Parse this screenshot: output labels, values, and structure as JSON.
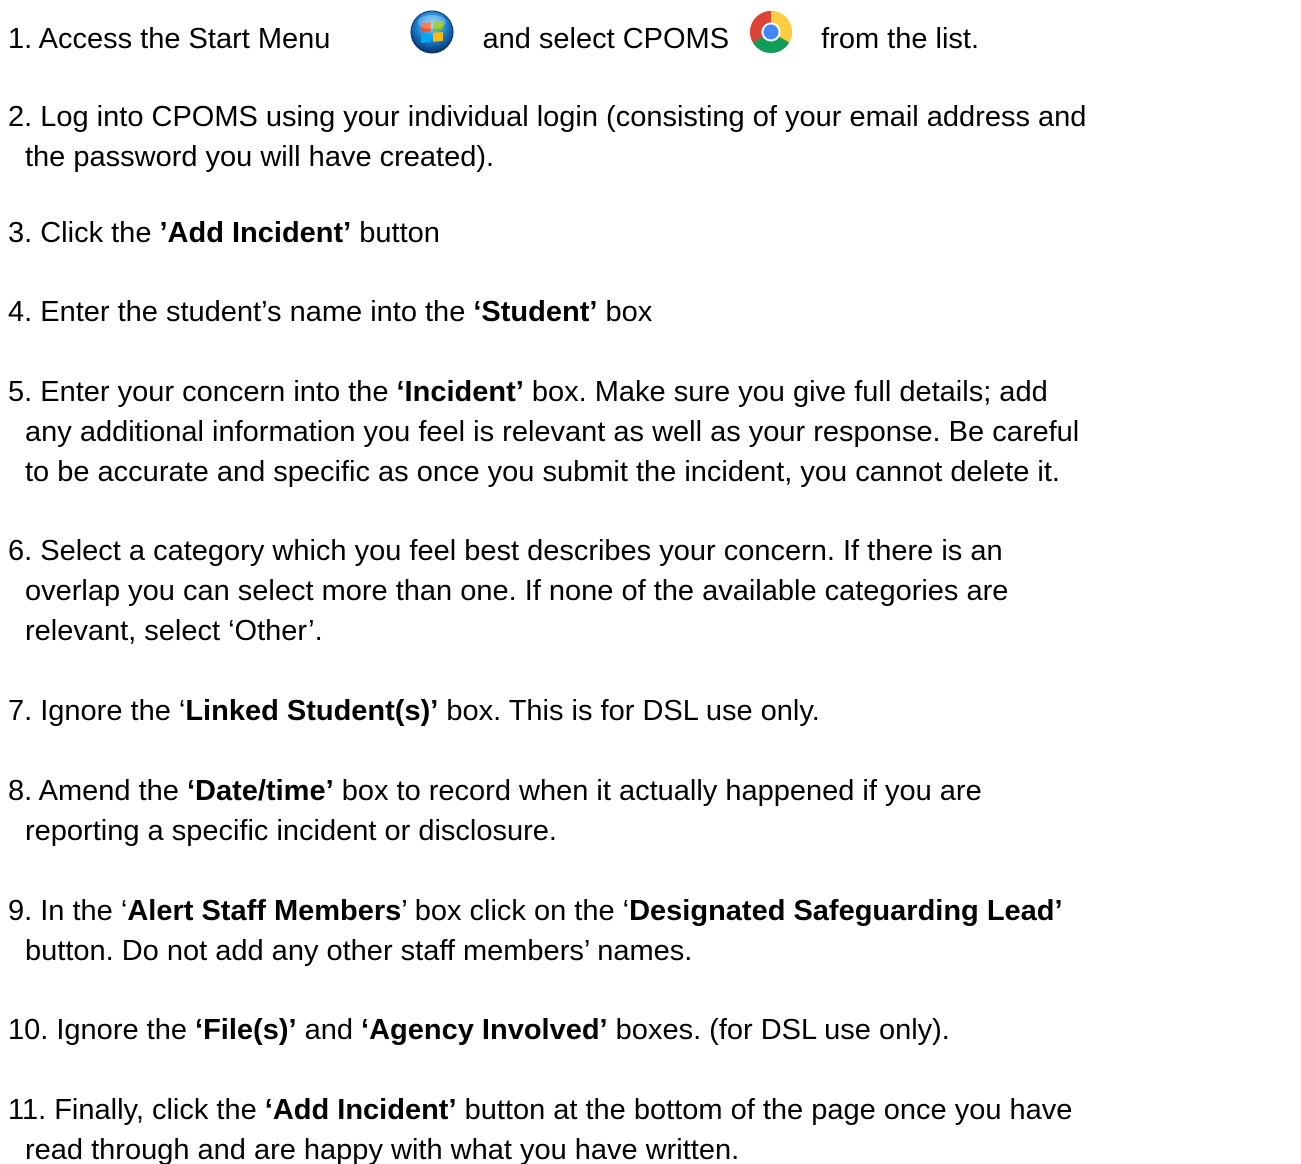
{
  "steps": [
    {
      "id": "step1",
      "segments": [
        {
          "text": "1. Access the Start Menu"
        },
        {
          "icon": "windows-start-orb-icon"
        },
        {
          "text": " and select CPOMS"
        },
        {
          "icon": "chrome-icon"
        },
        {
          "text": " from the list."
        }
      ]
    },
    {
      "id": "step2",
      "lines": [
        [
          {
            "text": "2. Log into CPOMS using your individual login (consisting of your email address and"
          }
        ],
        [
          {
            "text": "the password you will have created)."
          }
        ]
      ]
    },
    {
      "id": "step3",
      "lines": [
        [
          {
            "text": "3. Click the "
          },
          {
            "text": "’Add Incident’",
            "bold": true
          },
          {
            "text": " button"
          }
        ]
      ]
    },
    {
      "id": "step4",
      "lines": [
        [
          {
            "text": "4. Enter the student’s name into the "
          },
          {
            "text": "‘Student’",
            "bold": true
          },
          {
            "text": " box"
          }
        ]
      ]
    },
    {
      "id": "step5",
      "lines": [
        [
          {
            "text": "5. Enter your concern into the "
          },
          {
            "text": "‘Incident’",
            "bold": true
          },
          {
            "text": " box. Make sure you give full details; add"
          }
        ],
        [
          {
            "text": "any additional information you feel is relevant as well as your response. Be careful"
          }
        ],
        [
          {
            "text": "to be accurate and specific as once you submit the incident, you cannot delete it."
          }
        ]
      ]
    },
    {
      "id": "step6",
      "lines": [
        [
          {
            "text": "6. Select a category which you feel best describes your concern. If there is an"
          }
        ],
        [
          {
            "text": "overlap you can select more than one. If none of the available categories are"
          }
        ],
        [
          {
            "text": "relevant, select ‘Other’."
          }
        ]
      ]
    },
    {
      "id": "step7",
      "lines": [
        [
          {
            "text": "7. Ignore the ‘"
          },
          {
            "text": "Linked Student(s)’",
            "bold": true
          },
          {
            "text": " box. This is for DSL use only."
          }
        ]
      ]
    },
    {
      "id": "step8",
      "lines": [
        [
          {
            "text": "8. Amend the "
          },
          {
            "text": "‘Date/time’",
            "bold": true
          },
          {
            "text": " box to record when it actually happened if you are"
          }
        ],
        [
          {
            "text": "reporting a specific incident or disclosure."
          }
        ]
      ]
    },
    {
      "id": "step9",
      "lines": [
        [
          {
            "text": "9. In the ‘"
          },
          {
            "text": "Alert Staff Members",
            "bold": true
          },
          {
            "text": "’ box click on the ‘"
          },
          {
            "text": "Designated Safeguarding Lead’",
            "bold": true
          }
        ],
        [
          {
            "text": "button. Do not add any other staff members’ names."
          }
        ]
      ]
    },
    {
      "id": "step10",
      "lines": [
        [
          {
            "text": "10.  Ignore the "
          },
          {
            "text": "‘File(s)’",
            "bold": true
          },
          {
            "text": " and "
          },
          {
            "text": "‘Agency Involved’",
            "bold": true
          },
          {
            "text": " boxes. (for DSL use only)."
          }
        ]
      ]
    },
    {
      "id": "step11",
      "lines": [
        [
          {
            "text": "11.  Finally, click the "
          },
          {
            "text": "‘Add Incident’",
            "bold": true
          },
          {
            "text": " button at the bottom of the page once you have"
          }
        ],
        [
          {
            "text": "read through and are happy with what you have written."
          }
        ]
      ]
    }
  ]
}
